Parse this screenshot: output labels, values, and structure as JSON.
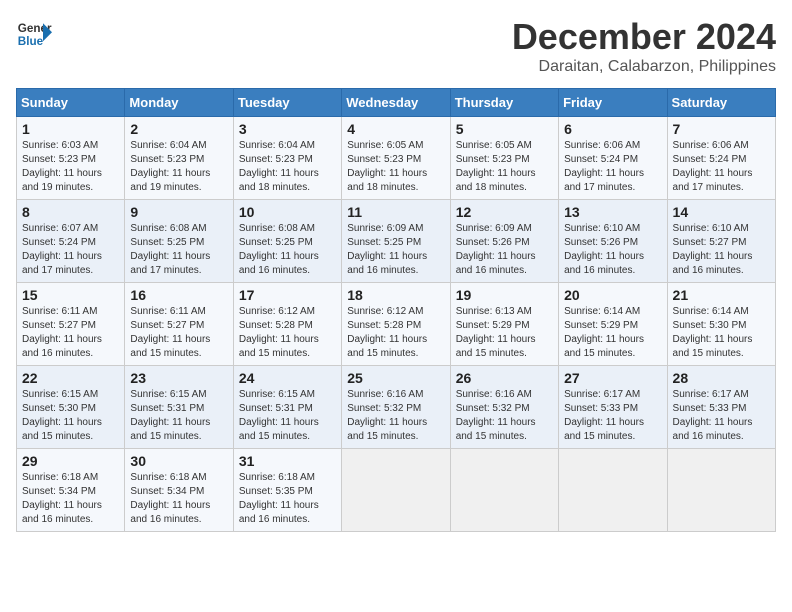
{
  "logo": {
    "line1": "General",
    "line2": "Blue"
  },
  "title": "December 2024",
  "subtitle": "Daraitan, Calabarzon, Philippines",
  "days_of_week": [
    "Sunday",
    "Monday",
    "Tuesday",
    "Wednesday",
    "Thursday",
    "Friday",
    "Saturday"
  ],
  "weeks": [
    [
      {
        "day": "1",
        "info": "Sunrise: 6:03 AM\nSunset: 5:23 PM\nDaylight: 11 hours\nand 19 minutes."
      },
      {
        "day": "2",
        "info": "Sunrise: 6:04 AM\nSunset: 5:23 PM\nDaylight: 11 hours\nand 19 minutes."
      },
      {
        "day": "3",
        "info": "Sunrise: 6:04 AM\nSunset: 5:23 PM\nDaylight: 11 hours\nand 18 minutes."
      },
      {
        "day": "4",
        "info": "Sunrise: 6:05 AM\nSunset: 5:23 PM\nDaylight: 11 hours\nand 18 minutes."
      },
      {
        "day": "5",
        "info": "Sunrise: 6:05 AM\nSunset: 5:23 PM\nDaylight: 11 hours\nand 18 minutes."
      },
      {
        "day": "6",
        "info": "Sunrise: 6:06 AM\nSunset: 5:24 PM\nDaylight: 11 hours\nand 17 minutes."
      },
      {
        "day": "7",
        "info": "Sunrise: 6:06 AM\nSunset: 5:24 PM\nDaylight: 11 hours\nand 17 minutes."
      }
    ],
    [
      {
        "day": "8",
        "info": "Sunrise: 6:07 AM\nSunset: 5:24 PM\nDaylight: 11 hours\nand 17 minutes."
      },
      {
        "day": "9",
        "info": "Sunrise: 6:08 AM\nSunset: 5:25 PM\nDaylight: 11 hours\nand 17 minutes."
      },
      {
        "day": "10",
        "info": "Sunrise: 6:08 AM\nSunset: 5:25 PM\nDaylight: 11 hours\nand 16 minutes."
      },
      {
        "day": "11",
        "info": "Sunrise: 6:09 AM\nSunset: 5:25 PM\nDaylight: 11 hours\nand 16 minutes."
      },
      {
        "day": "12",
        "info": "Sunrise: 6:09 AM\nSunset: 5:26 PM\nDaylight: 11 hours\nand 16 minutes."
      },
      {
        "day": "13",
        "info": "Sunrise: 6:10 AM\nSunset: 5:26 PM\nDaylight: 11 hours\nand 16 minutes."
      },
      {
        "day": "14",
        "info": "Sunrise: 6:10 AM\nSunset: 5:27 PM\nDaylight: 11 hours\nand 16 minutes."
      }
    ],
    [
      {
        "day": "15",
        "info": "Sunrise: 6:11 AM\nSunset: 5:27 PM\nDaylight: 11 hours\nand 16 minutes."
      },
      {
        "day": "16",
        "info": "Sunrise: 6:11 AM\nSunset: 5:27 PM\nDaylight: 11 hours\nand 15 minutes."
      },
      {
        "day": "17",
        "info": "Sunrise: 6:12 AM\nSunset: 5:28 PM\nDaylight: 11 hours\nand 15 minutes."
      },
      {
        "day": "18",
        "info": "Sunrise: 6:12 AM\nSunset: 5:28 PM\nDaylight: 11 hours\nand 15 minutes."
      },
      {
        "day": "19",
        "info": "Sunrise: 6:13 AM\nSunset: 5:29 PM\nDaylight: 11 hours\nand 15 minutes."
      },
      {
        "day": "20",
        "info": "Sunrise: 6:14 AM\nSunset: 5:29 PM\nDaylight: 11 hours\nand 15 minutes."
      },
      {
        "day": "21",
        "info": "Sunrise: 6:14 AM\nSunset: 5:30 PM\nDaylight: 11 hours\nand 15 minutes."
      }
    ],
    [
      {
        "day": "22",
        "info": "Sunrise: 6:15 AM\nSunset: 5:30 PM\nDaylight: 11 hours\nand 15 minutes."
      },
      {
        "day": "23",
        "info": "Sunrise: 6:15 AM\nSunset: 5:31 PM\nDaylight: 11 hours\nand 15 minutes."
      },
      {
        "day": "24",
        "info": "Sunrise: 6:15 AM\nSunset: 5:31 PM\nDaylight: 11 hours\nand 15 minutes."
      },
      {
        "day": "25",
        "info": "Sunrise: 6:16 AM\nSunset: 5:32 PM\nDaylight: 11 hours\nand 15 minutes."
      },
      {
        "day": "26",
        "info": "Sunrise: 6:16 AM\nSunset: 5:32 PM\nDaylight: 11 hours\nand 15 minutes."
      },
      {
        "day": "27",
        "info": "Sunrise: 6:17 AM\nSunset: 5:33 PM\nDaylight: 11 hours\nand 15 minutes."
      },
      {
        "day": "28",
        "info": "Sunrise: 6:17 AM\nSunset: 5:33 PM\nDaylight: 11 hours\nand 16 minutes."
      }
    ],
    [
      {
        "day": "29",
        "info": "Sunrise: 6:18 AM\nSunset: 5:34 PM\nDaylight: 11 hours\nand 16 minutes."
      },
      {
        "day": "30",
        "info": "Sunrise: 6:18 AM\nSunset: 5:34 PM\nDaylight: 11 hours\nand 16 minutes."
      },
      {
        "day": "31",
        "info": "Sunrise: 6:18 AM\nSunset: 5:35 PM\nDaylight: 11 hours\nand 16 minutes."
      },
      {
        "day": "",
        "info": ""
      },
      {
        "day": "",
        "info": ""
      },
      {
        "day": "",
        "info": ""
      },
      {
        "day": "",
        "info": ""
      }
    ]
  ]
}
